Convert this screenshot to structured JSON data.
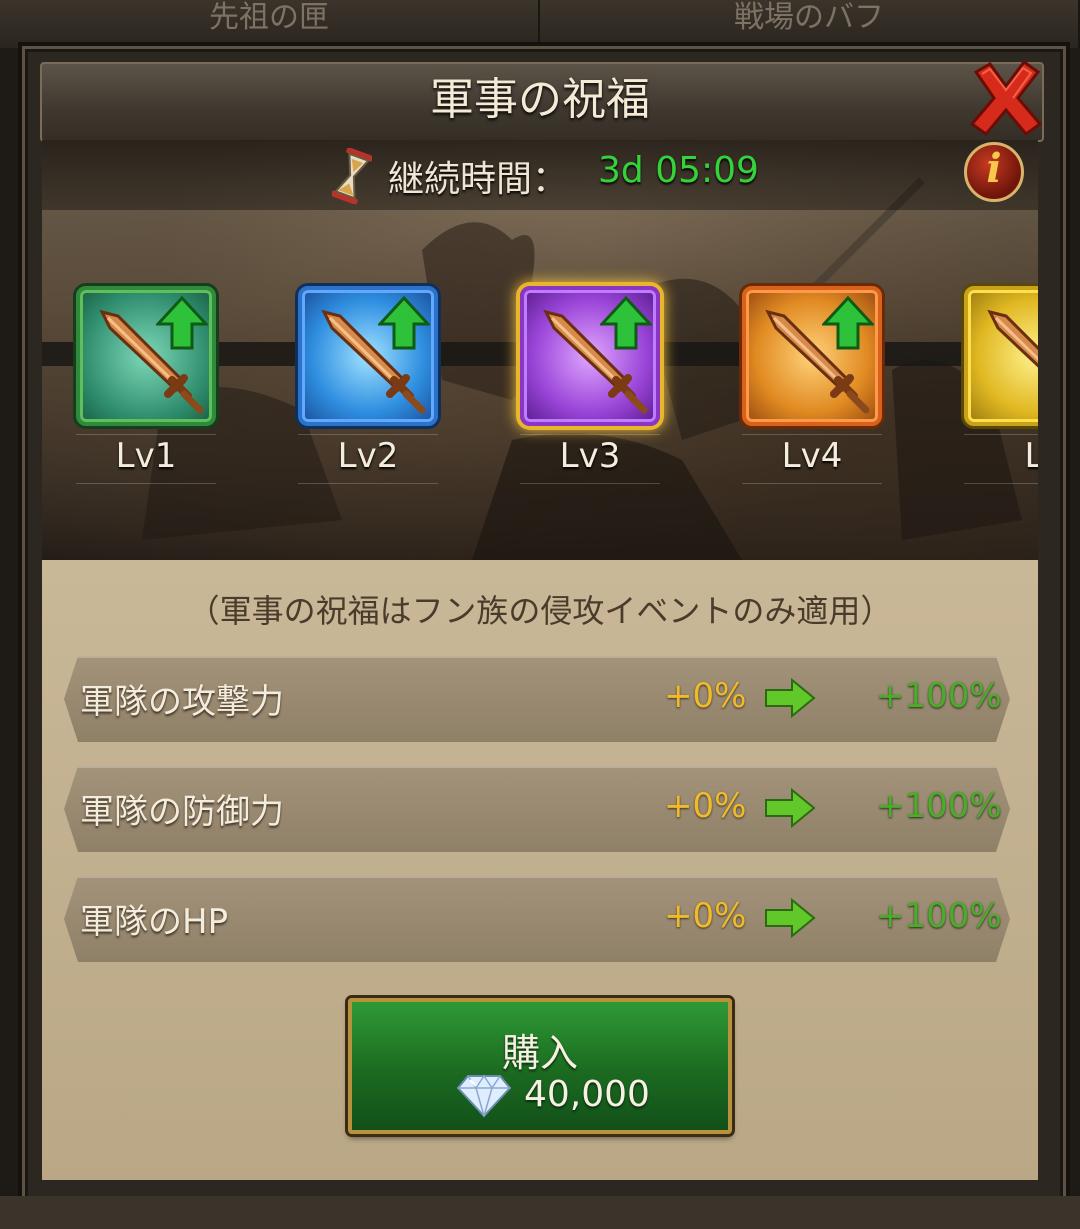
{
  "tabs": [
    {
      "label": "先祖の匣"
    },
    {
      "label": "戦場のバフ"
    }
  ],
  "dialog": {
    "title": "軍事の祝福",
    "timer_label": "継続時間：",
    "timer_value": "3d 05:09",
    "info_glyph": "i"
  },
  "levels": [
    {
      "label": "Lv1",
      "color": "#2f8a3c",
      "selected": false
    },
    {
      "label": "Lv2",
      "color": "#2a73c8",
      "selected": false
    },
    {
      "label": "Lv3",
      "color": "#8a35c4",
      "selected": true
    },
    {
      "label": "Lv4",
      "color": "#d9621a",
      "selected": false
    },
    {
      "label": "L",
      "color": "#c9a21a",
      "selected": false
    }
  ],
  "note": "（軍事の祝福はフン族の侵攻イベントのみ適用）",
  "stats": [
    {
      "label": "軍隊の攻撃力",
      "from": "+0%",
      "to": "+100%"
    },
    {
      "label": "軍隊の防御力",
      "from": "+0%",
      "to": "+100%"
    },
    {
      "label": "軍隊のHP",
      "from": "+0%",
      "to": "+100%"
    }
  ],
  "buy": {
    "label": "購入",
    "price": "40,000",
    "currency_icon": "diamond-icon"
  },
  "icons": {
    "close": "close-icon",
    "timer": "hourglass-icon",
    "info": "info-icon",
    "level": "sword-icon",
    "upgrade": "up-arrow-icon",
    "stat_arrow": "right-arrow-icon"
  },
  "colors": {
    "timer_value": "#35d33a",
    "stat_from": "#f0bb2a",
    "stat_to": "#49ad2a",
    "buy_button": "#1f7a24",
    "close_x": "#d62a1a"
  }
}
